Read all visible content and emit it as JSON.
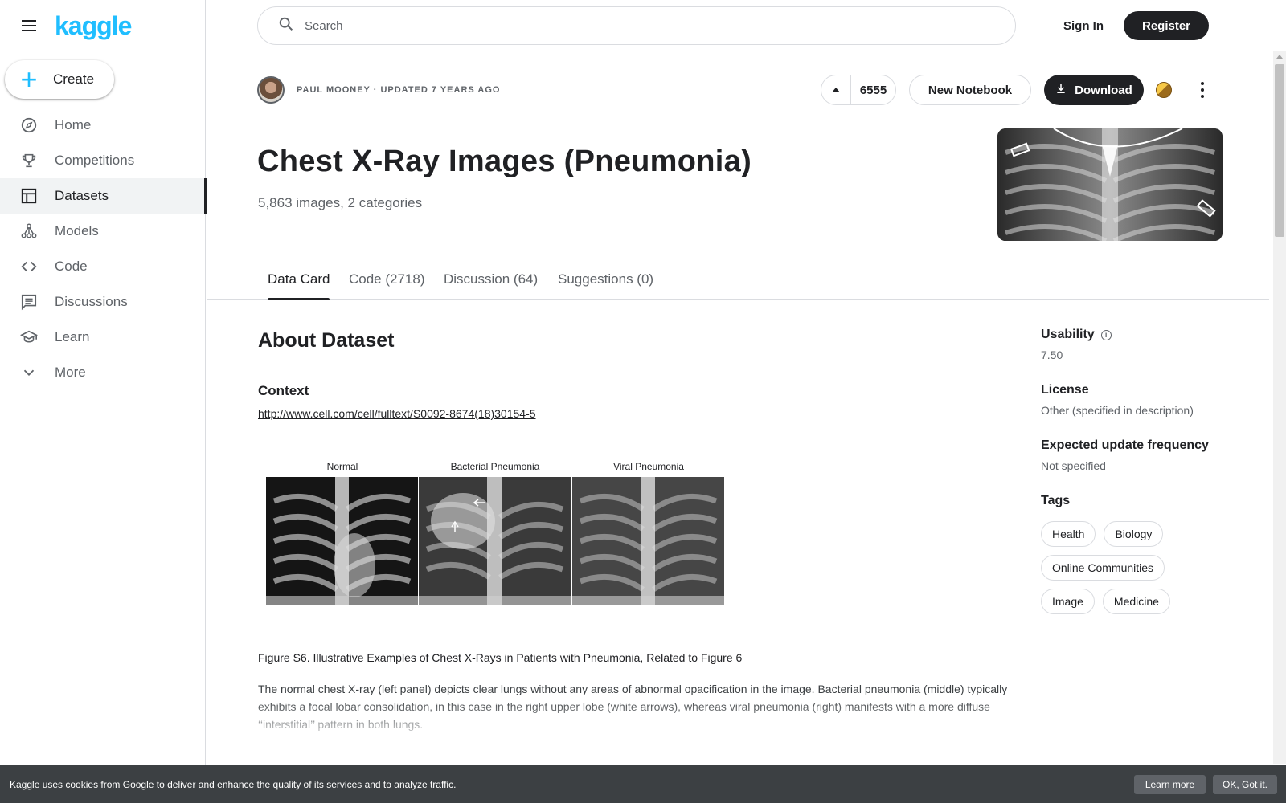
{
  "brand": {
    "logo_text": "kaggle",
    "accent_color": "#20beff"
  },
  "sidebar": {
    "create_label": "Create",
    "items": [
      {
        "label": "Home",
        "icon": "compass-icon"
      },
      {
        "label": "Competitions",
        "icon": "trophy-icon"
      },
      {
        "label": "Datasets",
        "icon": "table-icon",
        "active": true
      },
      {
        "label": "Models",
        "icon": "models-icon"
      },
      {
        "label": "Code",
        "icon": "code-icon"
      },
      {
        "label": "Discussions",
        "icon": "comments-icon"
      },
      {
        "label": "Learn",
        "icon": "school-icon"
      },
      {
        "label": "More",
        "icon": "chevron-down-icon"
      }
    ]
  },
  "header": {
    "search_placeholder": "Search",
    "sign_in": "Sign In",
    "register": "Register"
  },
  "dataset": {
    "meta": "PAUL MOONEY · UPDATED 7 YEARS AGO",
    "votes": "6555",
    "new_notebook": "New Notebook",
    "download": "Download",
    "title": "Chest X-Ray Images (Pneumonia)",
    "subtitle": "5,863 images, 2 categories"
  },
  "tabs": [
    {
      "label": "Data Card",
      "active": true
    },
    {
      "label": "Code (2718)"
    },
    {
      "label": "Discussion (64)"
    },
    {
      "label": "Suggestions (0)"
    }
  ],
  "main": {
    "about_heading": "About Dataset",
    "context_heading": "Context",
    "context_link": "http://www.cell.com/cell/fulltext/S0092-8674(18)30154-5",
    "figure_labels": [
      "Normal",
      "Bacterial Pneumonia",
      "Viral Pneumonia"
    ],
    "caption": "Figure S6. Illustrative Examples of Chest X-Rays in Patients with Pneumonia, Related to Figure 6",
    "body": "The normal chest X-ray (left panel) depicts clear lungs without any areas of abnormal opacification in the image. Bacterial pneumonia (middle) typically exhibits a focal lobar consolidation, in this case in the right upper lobe (white arrows), whereas viral pneumonia (right) manifests with a more diffuse ‘‘interstitial’’ pattern in both lungs."
  },
  "side": {
    "usability_label": "Usability",
    "usability_value": "7.50",
    "license_label": "License",
    "license_value": "Other (specified in description)",
    "update_label": "Expected update frequency",
    "update_value": "Not specified",
    "tags_label": "Tags",
    "tags": [
      "Health",
      "Biology",
      "Online Communities",
      "Image",
      "Medicine"
    ]
  },
  "cookie": {
    "text": "Kaggle uses cookies from Google to deliver and enhance the quality of its services and to analyze traffic.",
    "learn_more": "Learn more",
    "ok": "OK, Got it."
  }
}
